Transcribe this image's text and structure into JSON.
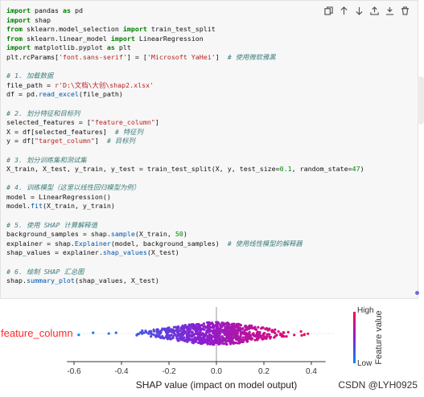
{
  "toolbar": {
    "icons": [
      "copy-icon",
      "move-up-icon",
      "move-down-icon",
      "export-icon",
      "insert-below-icon",
      "delete-icon"
    ]
  },
  "code_lines": [
    [
      [
        "kw",
        "import"
      ],
      [
        "t",
        " pandas "
      ],
      [
        "kw",
        "as"
      ],
      [
        "t",
        " pd"
      ]
    ],
    [
      [
        "kw",
        "import"
      ],
      [
        "t",
        " shap"
      ]
    ],
    [
      [
        "kw",
        "from"
      ],
      [
        "t",
        " sklearn.model_selection "
      ],
      [
        "kw",
        "import"
      ],
      [
        "t",
        " train_test_split"
      ]
    ],
    [
      [
        "kw",
        "from"
      ],
      [
        "t",
        " sklearn.linear_model "
      ],
      [
        "kw",
        "import"
      ],
      [
        "t",
        " LinearRegression"
      ]
    ],
    [
      [
        "kw",
        "import"
      ],
      [
        "t",
        " matplotlib.pyplot "
      ],
      [
        "kw",
        "as"
      ],
      [
        "t",
        " plt"
      ]
    ],
    [
      [
        "t",
        "plt.rcParams["
      ],
      [
        "str",
        "'font.sans-serif'"
      ],
      [
        "t",
        "] = ["
      ],
      [
        "str",
        "'Microsoft YaHei'"
      ],
      [
        "t",
        "]  "
      ],
      [
        "cm",
        "# 使用微软雅黑"
      ]
    ],
    [
      [
        "t",
        ""
      ]
    ],
    [
      [
        "cm",
        "# 1. 加载数据"
      ]
    ],
    [
      [
        "t",
        "file_path = "
      ],
      [
        "str",
        "r'D:\\文档\\大创\\shap2.xlsx'"
      ]
    ],
    [
      [
        "t",
        "df = pd."
      ],
      [
        "fn",
        "read_excel"
      ],
      [
        "t",
        "(file_path)"
      ]
    ],
    [
      [
        "t",
        ""
      ]
    ],
    [
      [
        "cm",
        "# 2. 划分特征和目标列"
      ]
    ],
    [
      [
        "t",
        "selected_features = ["
      ],
      [
        "str",
        "\"feature_column\""
      ],
      [
        "t",
        "]"
      ]
    ],
    [
      [
        "t",
        "X = df[selected_features]  "
      ],
      [
        "cm",
        "# 特征列"
      ]
    ],
    [
      [
        "t",
        "y = df["
      ],
      [
        "str",
        "\"target_column\""
      ],
      [
        "t",
        "]  "
      ],
      [
        "cm",
        "# 目标列"
      ]
    ],
    [
      [
        "t",
        ""
      ]
    ],
    [
      [
        "cm",
        "# 3. 划分训练集和测试集"
      ]
    ],
    [
      [
        "t",
        "X_train, X_test, y_train, y_test = train_test_split(X, y, test_size="
      ],
      [
        "num",
        "0.1"
      ],
      [
        "t",
        ", random_state="
      ],
      [
        "num",
        "47"
      ],
      [
        "t",
        ")"
      ]
    ],
    [
      [
        "t",
        ""
      ]
    ],
    [
      [
        "cm",
        "# 4. 训练模型（这里以线性回归模型为例）"
      ]
    ],
    [
      [
        "t",
        "model = LinearRegression()"
      ]
    ],
    [
      [
        "t",
        "model."
      ],
      [
        "fn",
        "fit"
      ],
      [
        "t",
        "(X_train, y_train)"
      ]
    ],
    [
      [
        "t",
        ""
      ]
    ],
    [
      [
        "cm",
        "# 5. 使用 SHAP 计算解释值"
      ]
    ],
    [
      [
        "t",
        "background_samples = shap."
      ],
      [
        "fn",
        "sample"
      ],
      [
        "t",
        "(X_train, "
      ],
      [
        "num",
        "50"
      ],
      [
        "t",
        ")"
      ]
    ],
    [
      [
        "t",
        "explainer = shap."
      ],
      [
        "fn",
        "Explainer"
      ],
      [
        "t",
        "(model, background_samples)  "
      ],
      [
        "cm",
        "# 使用线性模型的解释器"
      ]
    ],
    [
      [
        "t",
        "shap_values = explainer."
      ],
      [
        "fn",
        "shap_values"
      ],
      [
        "t",
        "(X_test)"
      ]
    ],
    [
      [
        "t",
        ""
      ]
    ],
    [
      [
        "cm",
        "# 6. 绘制 SHAP 汇总图"
      ]
    ],
    [
      [
        "t",
        "shap."
      ],
      [
        "fn",
        "summary_plot"
      ],
      [
        "t",
        "(shap_values, X_test)"
      ]
    ]
  ],
  "output": {
    "watermark": "CSDN @LYH0925"
  },
  "chart_data": {
    "type": "scatter",
    "title": "",
    "feature_labels": [
      "feature_column"
    ],
    "xlabel": "SHAP value (impact on model output)",
    "ylabel": "",
    "xlim": [
      -0.6,
      0.47
    ],
    "xticks": [
      "-0.6",
      "-0.4",
      "-0.2",
      "0.0",
      "0.2",
      "0.4"
    ],
    "xtick_values": [
      -0.6,
      -0.4,
      -0.2,
      0.0,
      0.2,
      0.4
    ],
    "shap_range": [
      -0.58,
      0.45
    ],
    "dense_range": [
      -0.38,
      0.36
    ],
    "colorbar": {
      "title": "Feature value",
      "high_label": "High",
      "low_label": "Low",
      "low_color": "#008afb",
      "mid_color": "#8a1fd0",
      "high_color": "#ff0052"
    },
    "grid": false,
    "legend": "colorbar-right"
  }
}
